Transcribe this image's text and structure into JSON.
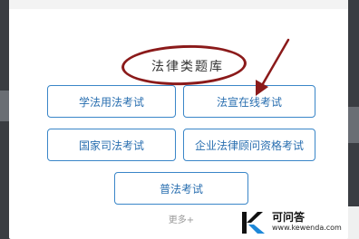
{
  "dialog": {
    "title": "法律类题库",
    "buttons": [
      "学法用法考试",
      "法宣在线考试",
      "国家司法考试",
      "企业法律顾问资格考试",
      "普法考试"
    ],
    "more": "更多+"
  },
  "annotation": {
    "highlight_color": "#8b1a1a"
  },
  "watermark": {
    "name": "可问答",
    "url": "www.kewenda.com",
    "accent": "#1e88d8"
  }
}
